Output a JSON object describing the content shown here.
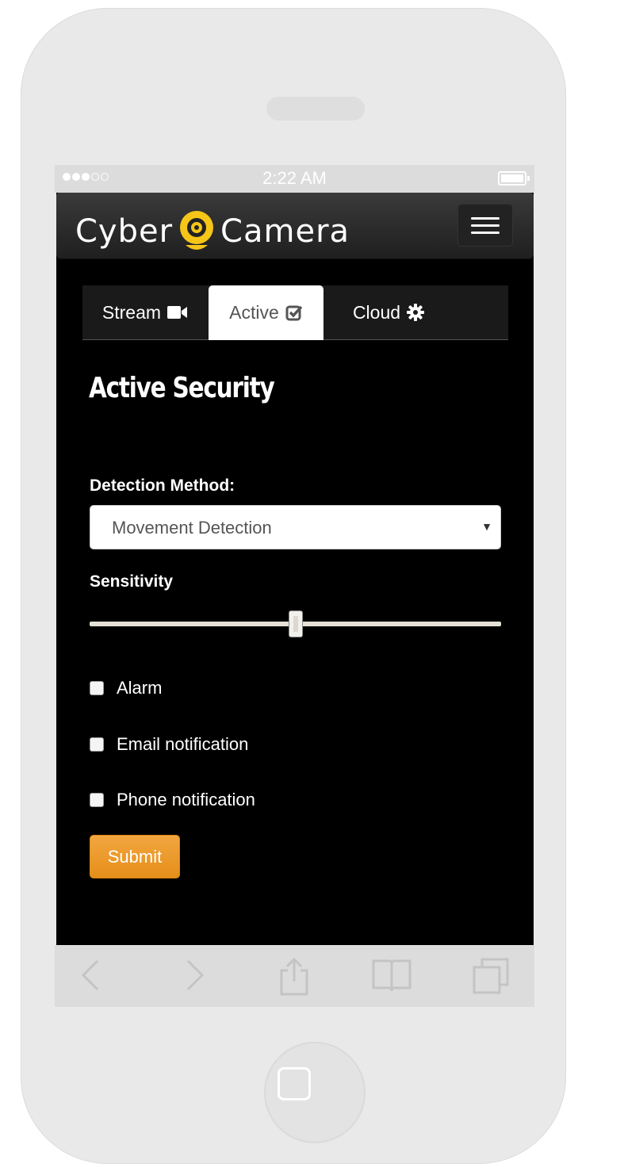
{
  "status_bar": {
    "time": "2:22 AM",
    "signal_dots": 5,
    "signal_filled": 3
  },
  "app": {
    "logo_left": "Cyber",
    "logo_right": "Camera",
    "brand_color": "#f5c518"
  },
  "tabs": [
    {
      "label": "Stream",
      "icon": "video-camera-icon"
    },
    {
      "label": "Active",
      "icon": "check-square-icon",
      "active": true
    },
    {
      "label": "Cloud",
      "icon": "gear-icon"
    }
  ],
  "page": {
    "title": "Active Security"
  },
  "form": {
    "detection_label": "Detection Method:",
    "detection_value": "Movement Detection",
    "sensitivity_label": "Sensitivity",
    "sensitivity_value": 0.5,
    "checkboxes": [
      {
        "label": "Alarm",
        "checked": false
      },
      {
        "label": "Email notification",
        "checked": false
      },
      {
        "label": "Phone notification",
        "checked": false
      }
    ],
    "submit_label": "Submit",
    "submit_color": "#ec9a2a"
  },
  "toolbar": {
    "icons": [
      "back-icon",
      "forward-icon",
      "share-icon",
      "bookmarks-icon",
      "tabs-icon"
    ]
  }
}
